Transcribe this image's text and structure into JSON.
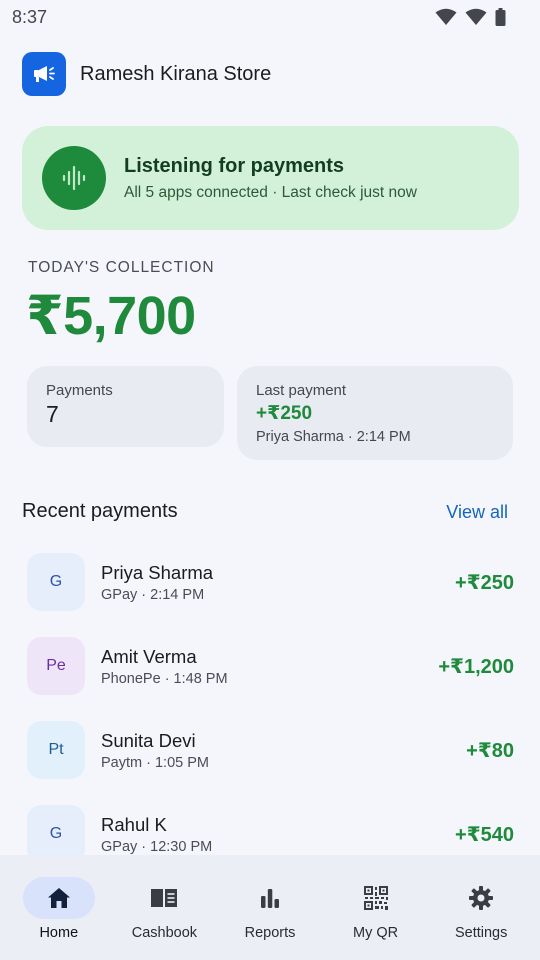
{
  "status_bar": {
    "time": "8:37",
    "icons": [
      "wifi-icon",
      "signal-icon",
      "battery-icon"
    ]
  },
  "header": {
    "store_name": "Ramesh Kirana Store",
    "logo_icon": "megaphone-icon"
  },
  "listening": {
    "icon": "soundwave-icon",
    "title": "Listening for payments",
    "subtitle": "All 5 apps connected · Last check just now"
  },
  "collection": {
    "label": "TODAY'S COLLECTION",
    "amount": "₹5,700"
  },
  "stats": {
    "payments_label": "Payments",
    "payments_count": "7",
    "last_label": "Last payment",
    "last_amount": "+₹250",
    "last_meta": "Priya Sharma · 2:14 PM"
  },
  "recent": {
    "title": "Recent payments",
    "view_all": "View all",
    "items": [
      {
        "initials": "G",
        "name": "Priya Sharma",
        "meta": "GPay · 2:14 PM",
        "amount": "+₹250",
        "avatar_bg": "#e6edfb",
        "avatar_fg": "#2f55a8"
      },
      {
        "initials": "Pe",
        "name": "Amit Verma",
        "meta": "PhonePe · 1:48 PM",
        "amount": "+₹1,200",
        "avatar_bg": "#efe5f8",
        "avatar_fg": "#6b2fa0"
      },
      {
        "initials": "Pt",
        "name": "Sunita Devi",
        "meta": "Paytm · 1:05 PM",
        "amount": "+₹80",
        "avatar_bg": "#e2f0fb",
        "avatar_fg": "#1f5c8f"
      },
      {
        "initials": "G",
        "name": "Rahul K",
        "meta": "GPay · 12:30 PM",
        "amount": "+₹540",
        "avatar_bg": "#e6edfb",
        "avatar_fg": "#2f55a8"
      }
    ]
  },
  "nav": {
    "items": [
      {
        "label": "Home",
        "icon": "home-icon",
        "active": true
      },
      {
        "label": "Cashbook",
        "icon": "book-icon",
        "active": false
      },
      {
        "label": "Reports",
        "icon": "bar-chart-icon",
        "active": false
      },
      {
        "label": "My QR",
        "icon": "qr-code-icon",
        "active": false
      },
      {
        "label": "Settings",
        "icon": "gear-icon",
        "active": false
      }
    ]
  },
  "colors": {
    "accent_green": "#1f8a3c",
    "link_blue": "#1565c0",
    "listen_bg": "#d3f1d9",
    "logo_blue": "#1565e0"
  }
}
